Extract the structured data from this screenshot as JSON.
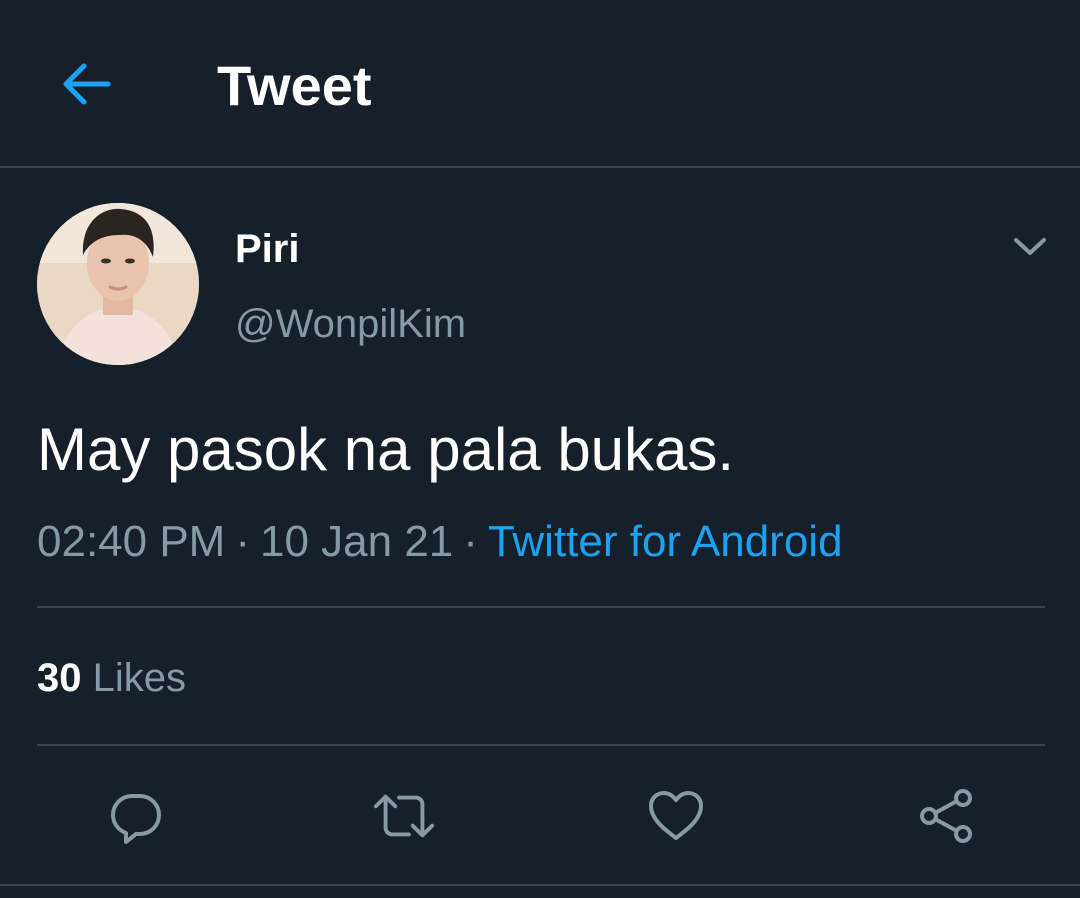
{
  "header": {
    "title": "Tweet",
    "back_icon": "arrow-left-icon"
  },
  "tweet": {
    "display_name": "Piri",
    "handle": "@WonpilKim",
    "text": "May pasok na pala bukas.",
    "time": "02:40 PM",
    "separator": "·",
    "date": "10 Jan 21",
    "source": "Twitter for Android",
    "likes_count": "30",
    "likes_label": "Likes",
    "more_icon": "chevron-down-icon"
  },
  "actions": {
    "reply_icon": "reply-icon",
    "retweet_icon": "retweet-icon",
    "like_icon": "heart-icon",
    "share_icon": "share-icon"
  },
  "colors": {
    "background": "#15202b",
    "accent": "#1da1f2",
    "secondary_text": "#8899a6",
    "border": "#38444d"
  }
}
